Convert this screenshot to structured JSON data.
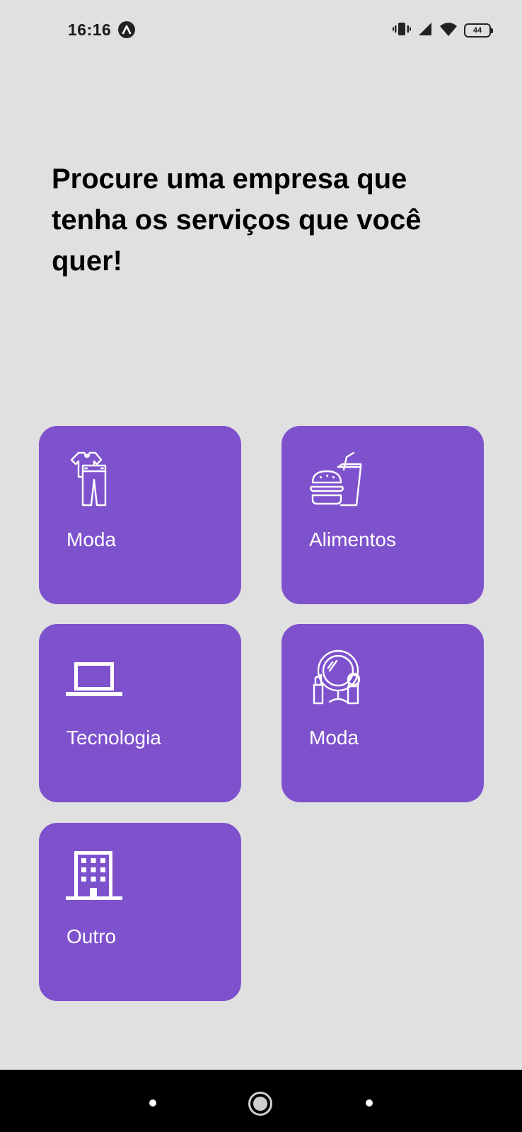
{
  "status_bar": {
    "time": "16:16",
    "battery_level": "44",
    "icons": [
      "app-notification-icon",
      "vibrate-icon",
      "cell-signal-icon",
      "wifi-icon",
      "battery-icon"
    ]
  },
  "headline": "Procure uma empresa que tenha os serviços que você quer!",
  "categories": [
    {
      "label": "Moda",
      "icon": "clothes-icon"
    },
    {
      "label": "Alimentos",
      "icon": "fast-food-icon"
    },
    {
      "label": "Tecnologia",
      "icon": "laptop-icon"
    },
    {
      "label": "Moda",
      "icon": "makeup-mirror-icon"
    },
    {
      "label": "Outro",
      "icon": "building-icon"
    }
  ],
  "colors": {
    "background": "#e0e0e0",
    "card": "#7e52cd",
    "card_text": "#ffffff",
    "nav_bar": "#000000"
  },
  "nav_bar": {
    "buttons": [
      "back-button",
      "home-button",
      "recents-button"
    ]
  }
}
